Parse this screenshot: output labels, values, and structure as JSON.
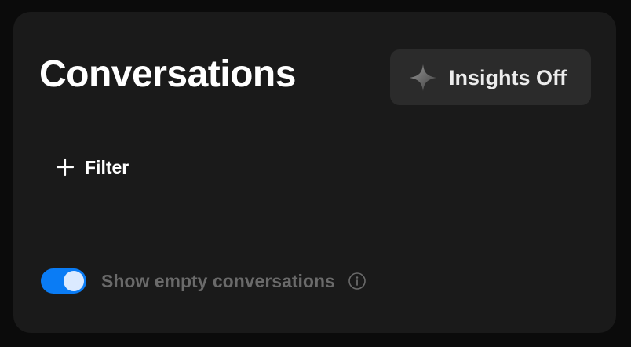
{
  "header": {
    "title": "Conversations",
    "insights_button": {
      "label": "Insights Off",
      "icon": "sparkle-icon"
    }
  },
  "filter": {
    "label": "Filter",
    "icon": "plus-icon"
  },
  "show_empty": {
    "label": "Show empty conversations",
    "enabled": true,
    "info_icon": "info-icon"
  },
  "colors": {
    "panel_background": "#1a1a1a",
    "page_background": "#0b0b0b",
    "button_background": "#2b2b2b",
    "toggle_on": "#0a7cf5",
    "toggle_knob": "#dbeaff",
    "muted_text": "#6a6a6a"
  }
}
